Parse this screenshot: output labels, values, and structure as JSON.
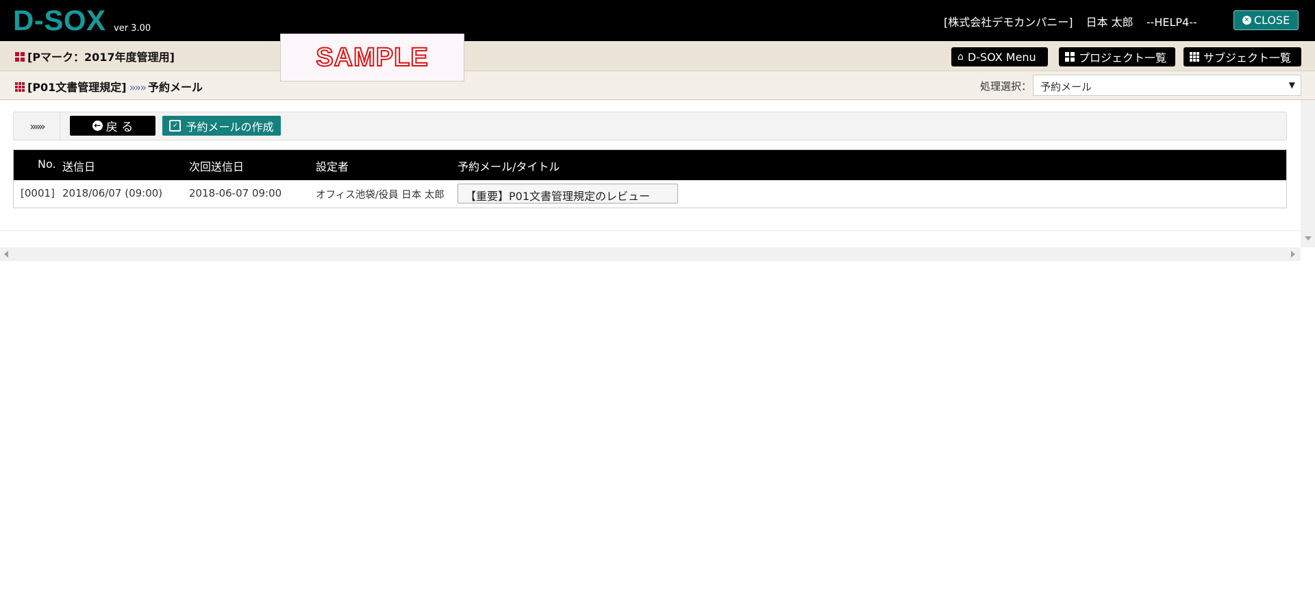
{
  "app": {
    "logo": "D-SOX",
    "version": "ver 3.00",
    "company": "[株式会社デモカンパニー]",
    "user": "日本 太郎",
    "help": "--HELP4--",
    "close_label": "CLOSE"
  },
  "project": {
    "title": "[Pマーク：2017年度管理用]",
    "sample_watermark": "SAMPLE"
  },
  "nav": {
    "dsox_menu": "D-SOX Menu",
    "project_list": "プロジェクト一覧",
    "subject_list": "サブジェクト一覧"
  },
  "breadcrumb": {
    "subject": "[P01文書管理規定]",
    "separator": "»»»",
    "current": "予約メール"
  },
  "process": {
    "label": "処理選択：",
    "selected": "予約メール"
  },
  "toolbar": {
    "toggle": "»»»",
    "back_label": "戻 る",
    "create_label": "予約メールの作成"
  },
  "table": {
    "headers": {
      "no": "No.",
      "sent_date": "送信日",
      "next_date": "次回送信日",
      "setter": "設定者",
      "title": "予約メール/タイトル"
    },
    "rows": [
      {
        "no": "[0001]",
        "sent_date": "2018/06/07 (09:00)",
        "next_date": "2018-06-07 09:00",
        "setter": "オフィス池袋/役員 日本 太郎",
        "title": "【重要】P01文書管理規定のレビュー"
      }
    ]
  },
  "colors": {
    "accent": "#159a9c",
    "button_teal": "#15807e",
    "header_bg": "#000000",
    "bar2_bg": "#ece4d7",
    "bar3_bg": "#f4f0e9",
    "icon_red": "#b5122f"
  }
}
